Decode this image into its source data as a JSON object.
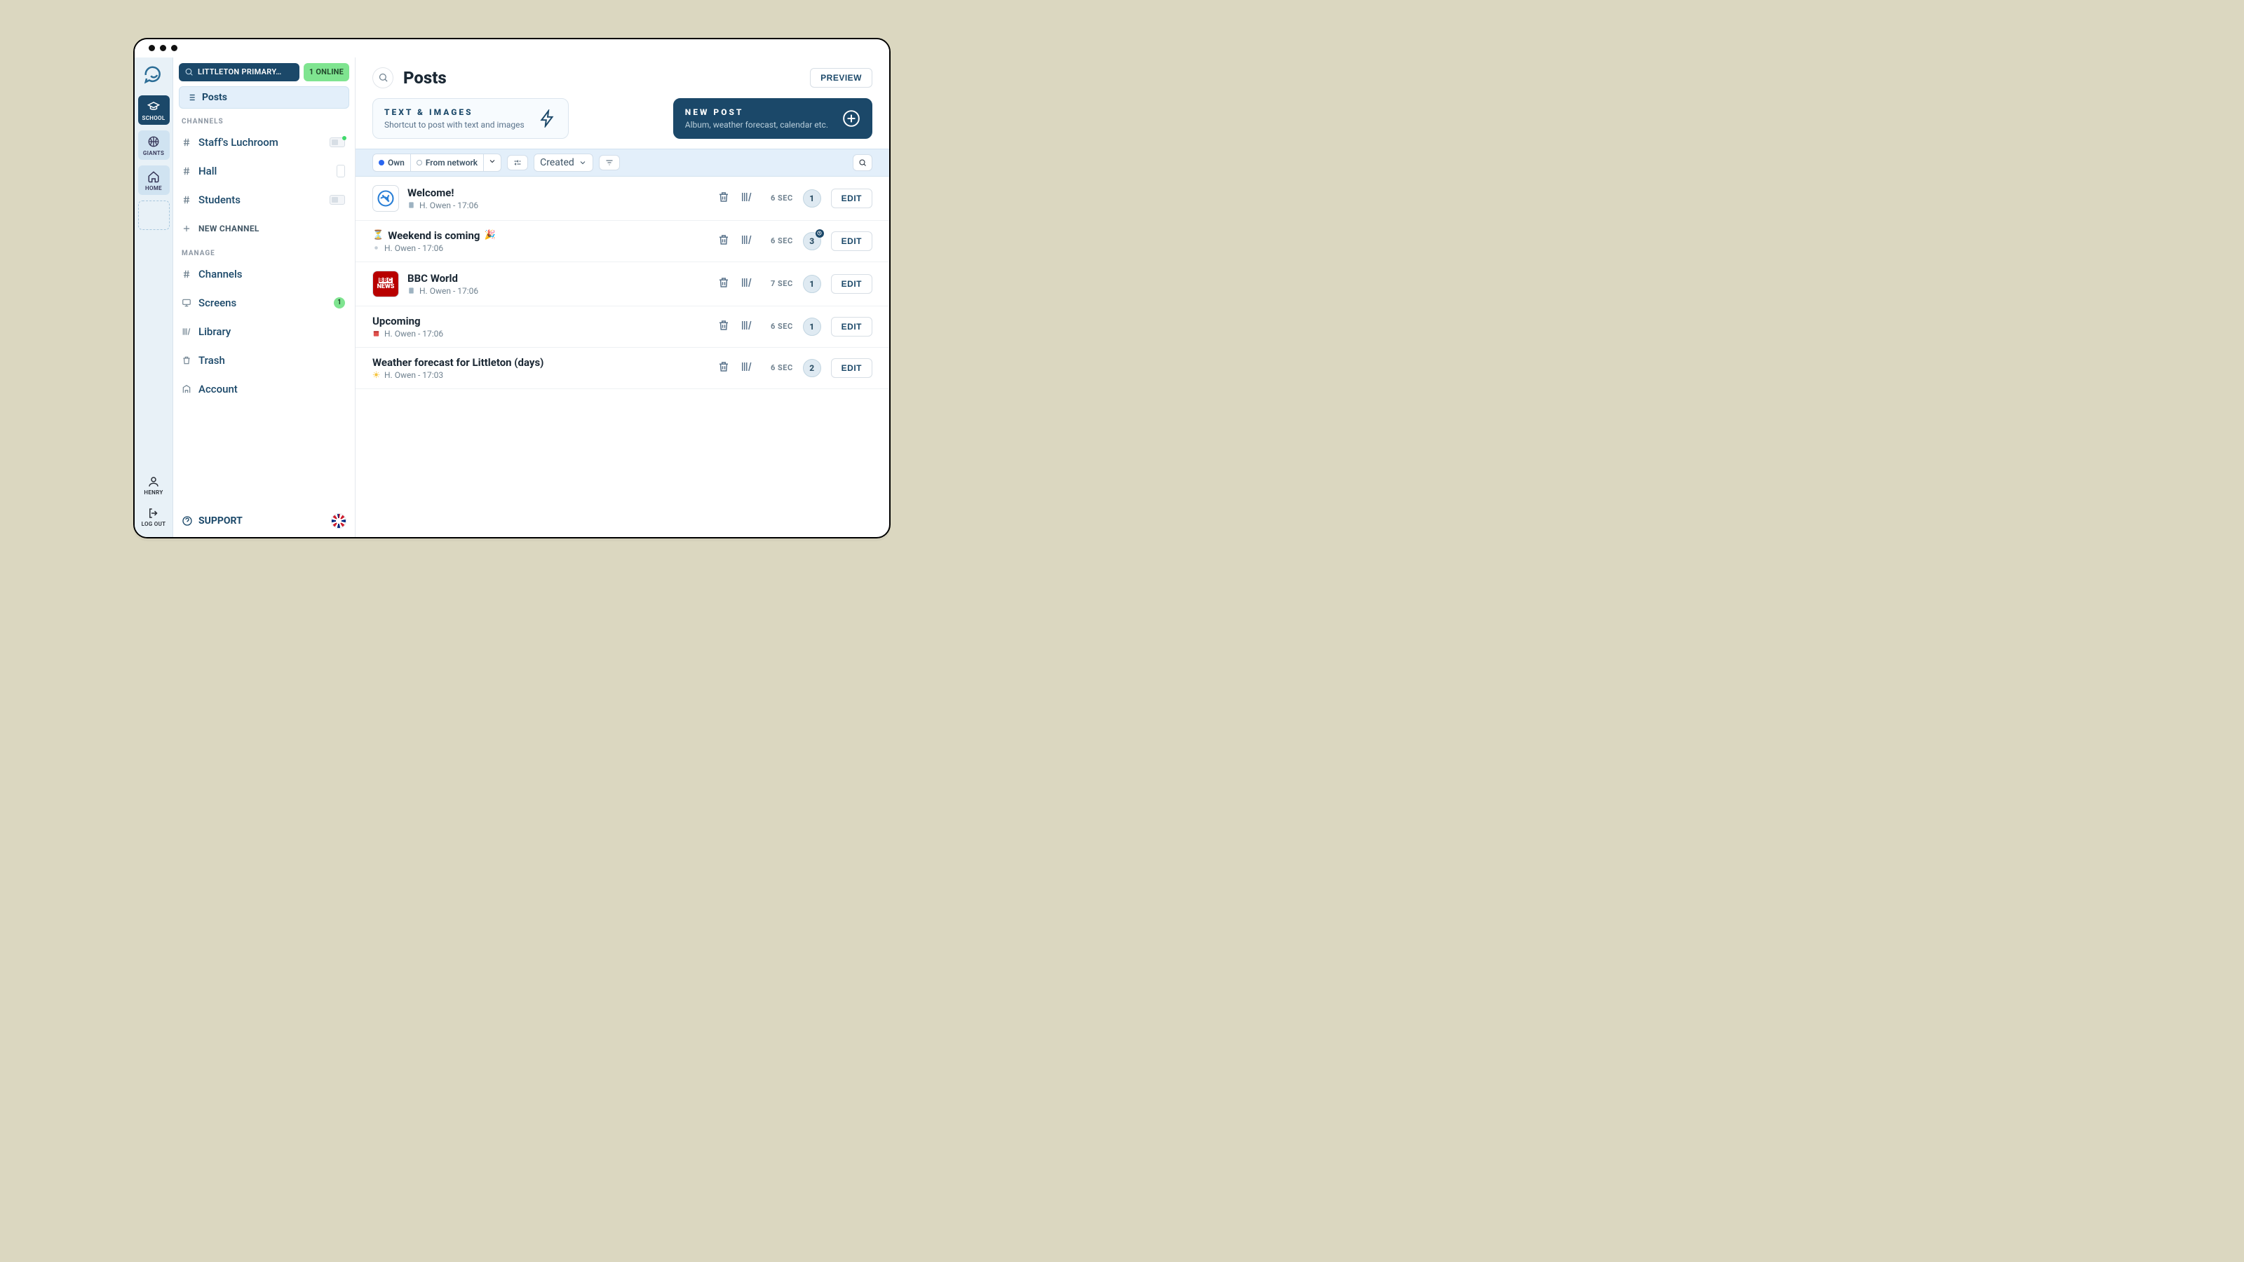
{
  "rail": {
    "items": [
      {
        "label": "SCHOOL"
      },
      {
        "label": "GIANTS"
      },
      {
        "label": "HOME"
      }
    ],
    "user": "HENRY",
    "logout": "LOG OUT"
  },
  "sidebar": {
    "search": "LITTLETON PRIMARY…",
    "online": "1 ONLINE",
    "posts": "Posts",
    "channels_header": "CHANNELS",
    "channels": [
      {
        "label": "Staff's Luchroom"
      },
      {
        "label": "Hall"
      },
      {
        "label": "Students"
      }
    ],
    "new_channel": "NEW CHANNEL",
    "manage_header": "MANAGE",
    "manage": {
      "channels": "Channels",
      "screens": "Screens",
      "screens_badge": "1",
      "library": "Library",
      "trash": "Trash",
      "account": "Account"
    },
    "support": "SUPPORT"
  },
  "main": {
    "title": "Posts",
    "preview": "PREVIEW",
    "card_text": {
      "title": "TEXT & IMAGES",
      "sub": "Shortcut to post with text and images"
    },
    "card_new": {
      "title": "NEW POST",
      "sub": "Album, weather forecast, calendar etc."
    },
    "filters": {
      "own": "Own",
      "network": "From network",
      "sort": "Created"
    }
  },
  "posts": [
    {
      "title": "Welcome!",
      "author": "H. Owen",
      "time": "17:06",
      "duration": "6 SEC",
      "count": "1",
      "edit": "EDIT",
      "thumb": "wave",
      "clock": false
    },
    {
      "title": "Weekend is coming",
      "author": "H. Owen",
      "time": "17:06",
      "duration": "6 SEC",
      "count": "3",
      "edit": "EDIT",
      "thumb": "",
      "pre": "⏳",
      "post": "🎉",
      "clock": true
    },
    {
      "title": "BBC World",
      "author": "H. Owen",
      "time": "17:06",
      "duration": "7 SEC",
      "count": "1",
      "edit": "EDIT",
      "thumb": "bbc",
      "clock": false
    },
    {
      "title": "Upcoming",
      "author": "H. Owen",
      "time": "17:06",
      "duration": "6 SEC",
      "count": "1",
      "edit": "EDIT",
      "thumb": "",
      "metaicon": "cal",
      "clock": false
    },
    {
      "title": "Weather forecast for Littleton (days)",
      "author": "H. Owen",
      "time": "17:03",
      "duration": "6 SEC",
      "count": "2",
      "edit": "EDIT",
      "thumb": "",
      "metaicon": "sun",
      "clock": false
    }
  ]
}
